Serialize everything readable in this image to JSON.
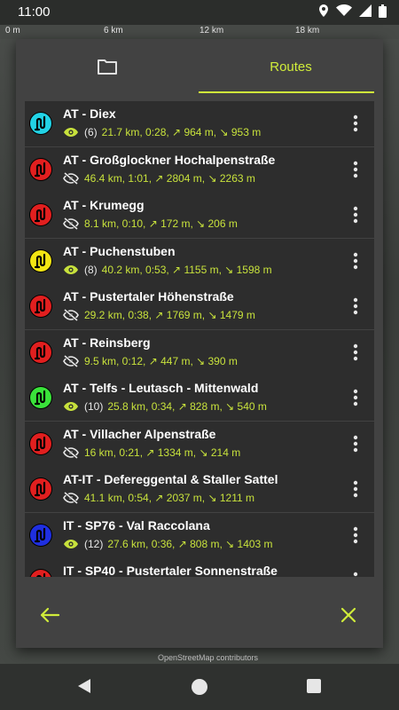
{
  "status": {
    "time": "11:00"
  },
  "scale": {
    "labels": [
      "0 m",
      "6 km",
      "12 km",
      "18 km"
    ]
  },
  "map": {
    "attribution": "OpenStreetMap contributors"
  },
  "dialog": {
    "tabs": [
      {
        "icon": "folder-icon",
        "label": ""
      },
      {
        "label": "Routes"
      }
    ],
    "accent_color": "#d0ec3a",
    "routes": [
      {
        "title": "AT - Diex",
        "visible": true,
        "count": "(6)",
        "stats": "21.7 km, 0:28, ↗ 964 m, ↘ 953 m",
        "color": "#22d3e6"
      },
      {
        "title": "AT - Großglockner Hochalpenstraße",
        "visible": false,
        "count": "",
        "stats": "46.4 km, 1:01, ↗ 2804 m, ↘ 2263 m",
        "color": "#e11f1f"
      },
      {
        "title": "AT - Krumegg",
        "visible": false,
        "count": "",
        "stats": "8.1 km, 0:10, ↗ 172 m, ↘ 206 m",
        "color": "#e11f1f"
      },
      {
        "title": "AT - Puchenstuben",
        "visible": true,
        "count": "(8)",
        "stats": "40.2 km, 0:53, ↗ 1155 m, ↘ 1598 m",
        "color": "#f3e513"
      },
      {
        "title": "AT - Pustertaler Höhenstraße",
        "visible": false,
        "count": "",
        "stats": "29.2 km, 0:38, ↗ 1769 m, ↘ 1479 m",
        "color": "#e11f1f"
      },
      {
        "title": "AT - Reinsberg",
        "visible": false,
        "count": "",
        "stats": "9.5 km, 0:12, ↗ 447 m, ↘ 390 m",
        "color": "#e11f1f"
      },
      {
        "title": "AT - Telfs - Leutasch - Mittenwald",
        "visible": true,
        "count": "(10)",
        "stats": "25.8 km, 0:34, ↗ 828 m, ↘ 540 m",
        "color": "#3ae23a"
      },
      {
        "title": "AT - Villacher Alpenstraße",
        "visible": false,
        "count": "",
        "stats": "16 km, 0:21, ↗ 1334 m, ↘ 214 m",
        "color": "#e11f1f"
      },
      {
        "title": "AT-IT - Defereggental & Staller Sattel",
        "visible": false,
        "count": "",
        "stats": "41.1 km, 0:54, ↗ 2037 m, ↘ 1211 m",
        "color": "#e11f1f"
      },
      {
        "title": "IT - SP76 - Val Raccolana",
        "visible": true,
        "count": "(12)",
        "stats": "27.6 km, 0:36, ↗ 808 m, ↘ 1403 m",
        "color": "#1f2fe0"
      },
      {
        "title": "IT - SP40 - Pustertaler Sonnenstraße",
        "visible": false,
        "count": "",
        "stats": "",
        "color": "#e11f1f"
      }
    ],
    "footer": {
      "back_icon": "arrow-left-icon",
      "close_icon": "close-icon"
    }
  }
}
